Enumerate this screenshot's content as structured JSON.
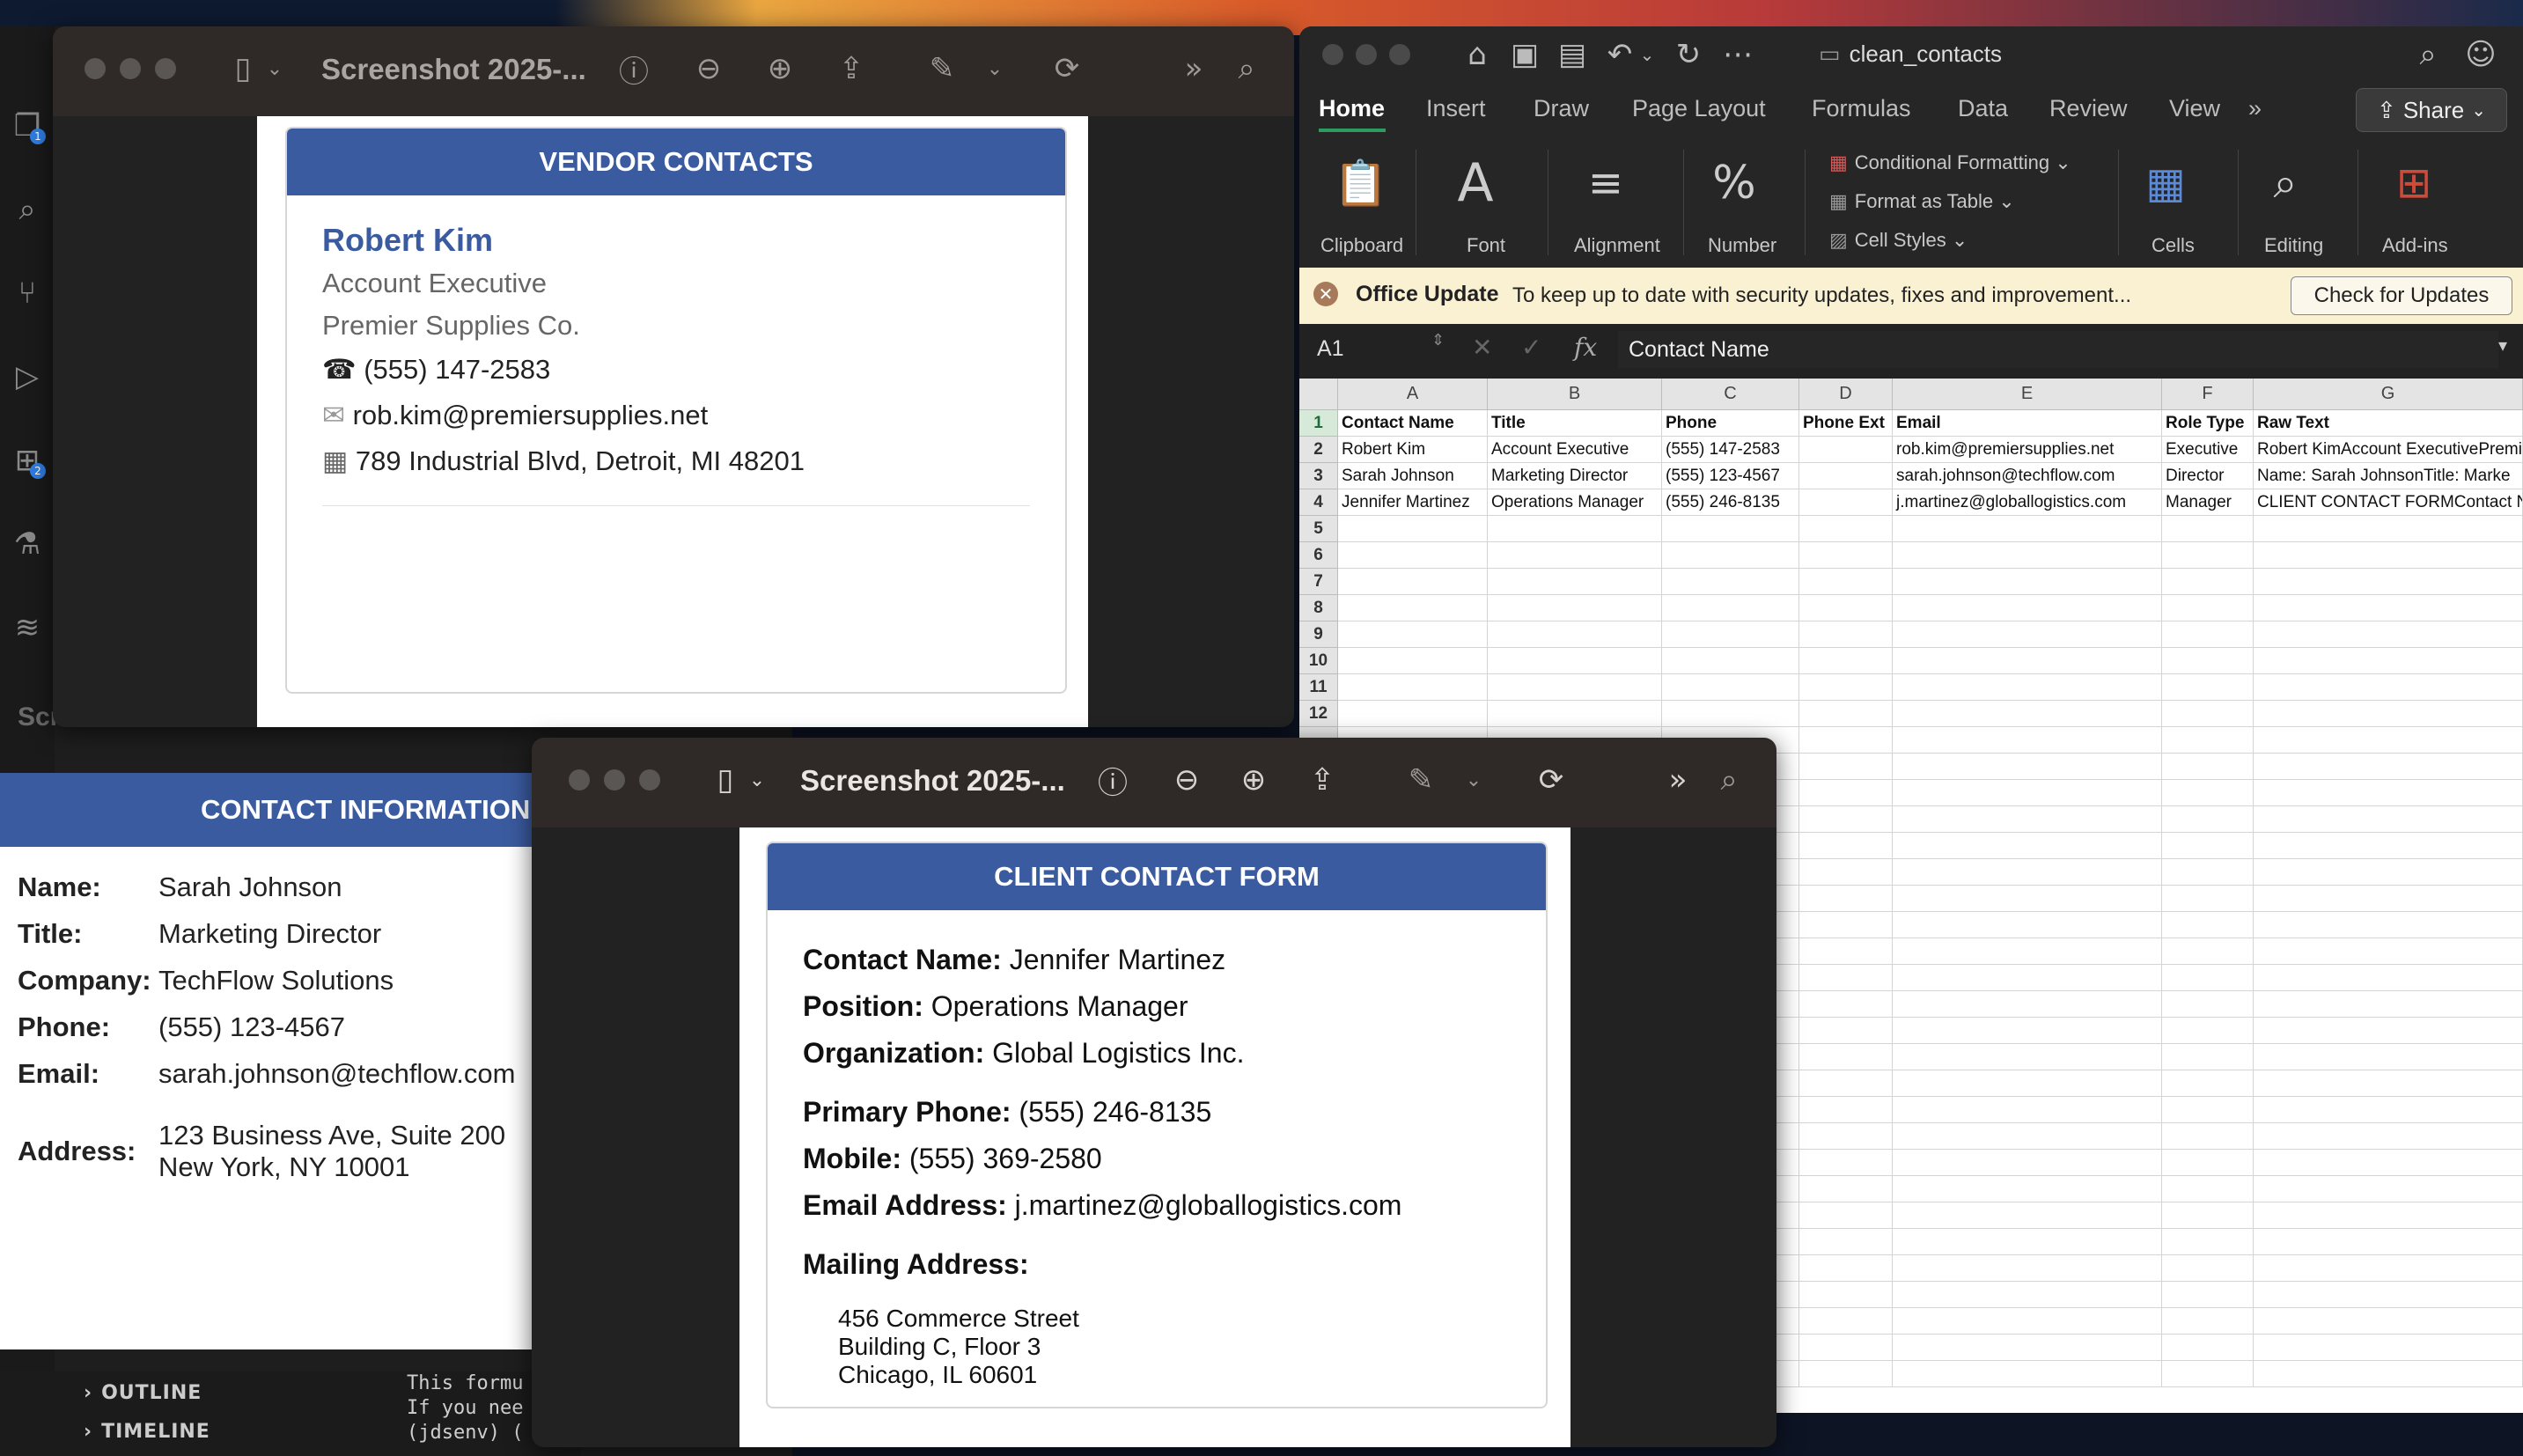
{
  "vscode": {
    "behind_title": "Screenshot 2025...",
    "outline": "OUTLINE",
    "timeline": "TIMELINE",
    "terminal_lines": [
      "This formu",
      "If you nee",
      "(jdsenv) ("
    ],
    "badge_explorer": "1",
    "badge_extensions": "2"
  },
  "contact_info": {
    "header": "CONTACT INFORMATION",
    "rows": [
      {
        "label": "Name:",
        "value": "Sarah Johnson"
      },
      {
        "label": "Title:",
        "value": "Marketing Director"
      },
      {
        "label": "Company:",
        "value": "TechFlow Solutions"
      },
      {
        "label": "Phone:",
        "value": "(555) 123-4567"
      },
      {
        "label": "Email:",
        "value": "sarah.johnson@techflow.com"
      },
      {
        "label": "Address:",
        "value": "123 Business Ave, Suite 200",
        "value2": "New York, NY 10001"
      }
    ]
  },
  "vendor_window": {
    "title": "Screenshot 2025-...",
    "header": "VENDOR CONTACTS",
    "name": "Robert Kim",
    "title_line": "Account Executive",
    "company": "Premier Supplies Co.",
    "phone": "(555) 147-2583",
    "email": "rob.kim@premiersupplies.net",
    "address": "789 Industrial Blvd, Detroit, MI 48201"
  },
  "client_window": {
    "title": "Screenshot 2025-...",
    "header": "CLIENT CONTACT FORM",
    "contact_name_label": "Contact Name:",
    "contact_name": "Jennifer Martinez",
    "position_label": "Position:",
    "position": "Operations Manager",
    "organization_label": "Organization:",
    "organization": "Global Logistics Inc.",
    "primary_phone_label": "Primary Phone:",
    "primary_phone": "(555) 246-8135",
    "mobile_label": "Mobile:",
    "mobile": "(555) 369-2580",
    "email_label": "Email Address:",
    "email": "j.martinez@globallogistics.com",
    "mailing_label": "Mailing Address:",
    "address_lines": [
      "456 Commerce Street",
      "Building C, Floor 3",
      "Chicago, IL 60601"
    ]
  },
  "excel": {
    "filename": "clean_contacts",
    "share_label": "Share",
    "tabs": [
      "Home",
      "Insert",
      "Draw",
      "Page Layout",
      "Formulas",
      "Data",
      "Review",
      "View"
    ],
    "ribbon": {
      "clipboard": "Clipboard",
      "font": "Font",
      "alignment": "Alignment",
      "number": "Number",
      "conditional_formatting": "Conditional Formatting",
      "format_as_table": "Format as Table",
      "cell_styles": "Cell Styles",
      "cells": "Cells",
      "editing": "Editing",
      "addins": "Add-ins"
    },
    "update_bar": {
      "title": "Office Update",
      "message": "To keep up to date with security updates, fixes and improvement...",
      "button": "Check for Updates"
    },
    "name_box": "A1",
    "formula_value": "Contact Name",
    "columns": [
      "A",
      "B",
      "C",
      "D",
      "E",
      "F",
      "G"
    ],
    "rows": [
      [
        "Contact Name",
        "Title",
        "Phone",
        "Phone Ext",
        "Email",
        "Role Type",
        "Raw Text"
      ],
      [
        "Robert Kim",
        "Account Executive",
        "(555) 147-2583",
        "",
        "rob.kim@premiersupplies.net",
        "Executive",
        "Robert KimAccount ExecutivePremier"
      ],
      [
        "Sarah Johnson",
        "Marketing Director",
        "(555) 123-4567",
        "",
        "sarah.johnson@techflow.com",
        "Director",
        "Name: Sarah JohnsonTitle: Marke"
      ],
      [
        "Jennifer Martinez",
        "Operations Manager",
        "(555) 246-8135",
        "",
        "j.martinez@globallogistics.com",
        "Manager",
        "CLIENT CONTACT FORMContact Na"
      ]
    ],
    "row_numbers": [
      "1",
      "2",
      "3",
      "4",
      "5",
      "6",
      "7",
      "8",
      "9",
      "10",
      "11",
      "12"
    ]
  }
}
